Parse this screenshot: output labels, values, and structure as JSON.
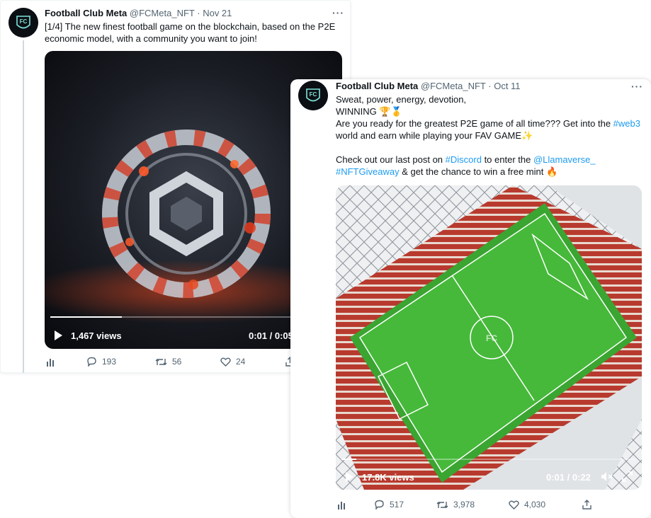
{
  "tweets": [
    {
      "name": "Football Club Meta",
      "handle": "@FCMeta_NFT",
      "separator": "·",
      "date": "Nov 21",
      "more": "···",
      "text": "[1/4] The new finest football game on the blockchain, based on the P2E economic model, with a community you want to join!",
      "video": {
        "views": "1,467 views",
        "time": "0:01 / 0:05",
        "progress": 0.25
      },
      "stats": {
        "replies": "193",
        "retweets": "56",
        "likes": "24"
      }
    },
    {
      "name": "Football Club Meta",
      "handle": "@FCMeta_NFT",
      "separator": "·",
      "date": "Oct 11",
      "more": "···",
      "lines": {
        "l1": "Sweat, power, energy, devotion,",
        "l2": "WINNING 🏆🥇",
        "l3a": "Are you ready for the greatest P2E game of all time??? Get into the ",
        "l3link": "#web3",
        "l4": "world and earn while playing your FAV GAME✨",
        "l5a": "Check out our last post on ",
        "l5link1": "#Discord",
        "l5b": " to enter the ",
        "l5link2": "@Llamaverse_",
        "l6link": "#NFTGiveaway",
        "l6b": " & get the chance to win a free mint 🔥"
      },
      "video": {
        "views": "17.8K views",
        "time": "0:01 / 0:22",
        "progress": 0.05
      },
      "stats": {
        "replies": "517",
        "retweets": "3,978",
        "likes": "4,030"
      }
    }
  ],
  "colors": {
    "link": "#1d9bf0",
    "muted": "#536471",
    "text": "#0f1419"
  }
}
